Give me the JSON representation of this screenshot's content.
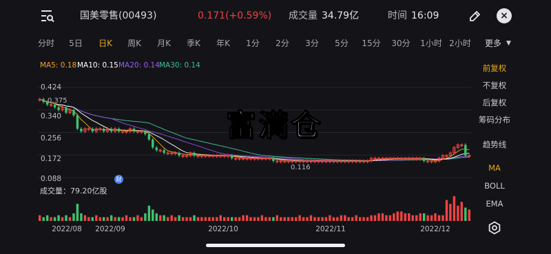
{
  "header": {
    "stock_name": "国美零售(00493)",
    "price_change": "0.171(+0.59%)",
    "volume_label": "成交量",
    "volume_value": "34.79亿",
    "time_label": "时间",
    "time_value": "16:09",
    "close_symbol": "×",
    "icons": [
      "menu-search-icon",
      "pencil-icon",
      "close-icon"
    ]
  },
  "tabs": [
    {
      "label": "分时",
      "active": false
    },
    {
      "label": "5日",
      "active": false
    },
    {
      "label": "日K",
      "active": true
    },
    {
      "label": "周K",
      "active": false
    },
    {
      "label": "月K",
      "active": false
    },
    {
      "label": "季K",
      "active": false
    },
    {
      "label": "年K",
      "active": false
    },
    {
      "label": "1分",
      "active": false
    },
    {
      "label": "2分",
      "active": false
    },
    {
      "label": "3分",
      "active": false
    },
    {
      "label": "5分",
      "active": false
    },
    {
      "label": "15分",
      "active": false
    },
    {
      "label": "30分",
      "active": false
    },
    {
      "label": "1小时",
      "active": false
    },
    {
      "label": "2小时",
      "active": false
    }
  ],
  "more_tab": "更多",
  "more_caret": "▼",
  "ma_legend": {
    "ma5": "MA5: 0.18",
    "ma10": "MA10: 0.15",
    "ma20": "MA20: 0.14",
    "ma30": "MA30: 0.14"
  },
  "y_axis_labels": [
    "0.424",
    "0.340",
    "0.256",
    "0.172",
    "0.088"
  ],
  "price_markers": {
    "high": "0.375",
    "low": "0.116"
  },
  "side_panel": {
    "adjust_options": [
      "前复权",
      "不复权",
      "后复权"
    ],
    "selected_adjust": "前复权",
    "chip_distribution": "筹码分布",
    "trendline": "趋势线",
    "indicators": [
      "MA",
      "BOLL",
      "EMA"
    ],
    "selected_indicator": "MA"
  },
  "volume_total": "成交量：79.20亿股",
  "x_axis_labels": [
    "2022/08",
    "2022/09",
    "2022/10",
    "2022/11",
    "2022/12"
  ],
  "watermark": "富满仓",
  "finance_badge": "财",
  "colors": {
    "up": "#ee4444",
    "down": "#3fc46f",
    "accent": "#e9a81a",
    "ma5": "#f0a41f",
    "ma10": "#ffffff",
    "ma20": "#8c4de0",
    "ma30": "#3fbf9a"
  },
  "chart_data": {
    "type": "candlestick",
    "ylim": [
      0.088,
      0.424
    ],
    "y_ticks": [
      0.424,
      0.34,
      0.256,
      0.172,
      0.088
    ],
    "x_ticks": [
      "2022/08",
      "2022/09",
      "2022/10",
      "2022/11",
      "2022/12"
    ],
    "price_high": 0.375,
    "price_low": 0.116,
    "ma": {
      "MA5": 0.18,
      "MA10": 0.15,
      "MA20": 0.14,
      "MA30": 0.14
    },
    "closes_approx": [
      0.38,
      0.37,
      0.36,
      0.36,
      0.35,
      0.34,
      0.35,
      0.33,
      0.34,
      0.32,
      0.27,
      0.26,
      0.27,
      0.27,
      0.26,
      0.27,
      0.27,
      0.26,
      0.27,
      0.26,
      0.27,
      0.26,
      0.26,
      0.26,
      0.27,
      0.26,
      0.26,
      0.26,
      0.25,
      0.23,
      0.2,
      0.19,
      0.19,
      0.18,
      0.18,
      0.18,
      0.18,
      0.17,
      0.17,
      0.17,
      0.18,
      0.17,
      0.17,
      0.17,
      0.17,
      0.17,
      0.17,
      0.17,
      0.17,
      0.17,
      0.17,
      0.16,
      0.16,
      0.16,
      0.16,
      0.16,
      0.16,
      0.16,
      0.16,
      0.16,
      0.16,
      0.16,
      0.15,
      0.15,
      0.15,
      0.15,
      0.15,
      0.15,
      0.15,
      0.15,
      0.15,
      0.15,
      0.15,
      0.15,
      0.15,
      0.15,
      0.15,
      0.15,
      0.15,
      0.15,
      0.15,
      0.15,
      0.15,
      0.15,
      0.15,
      0.15,
      0.15,
      0.15,
      0.16,
      0.16,
      0.16,
      0.16,
      0.16,
      0.16,
      0.16,
      0.16,
      0.16,
      0.16,
      0.16,
      0.16,
      0.16,
      0.16,
      0.15,
      0.15,
      0.15,
      0.15,
      0.16,
      0.17,
      0.17,
      0.18,
      0.2,
      0.21,
      0.21,
      0.17,
      0.17
    ],
    "volume_approx": [
      3,
      2,
      3,
      2,
      2,
      3,
      2,
      3,
      2,
      4,
      9,
      4,
      3,
      2,
      2,
      3,
      2,
      2,
      2,
      3,
      2,
      2,
      2,
      3,
      2,
      2,
      3,
      2,
      4,
      8,
      6,
      4,
      3,
      3,
      2,
      3,
      2,
      3,
      2,
      2,
      2,
      3,
      2,
      2,
      2,
      2,
      2,
      2,
      3,
      2,
      2,
      2,
      2,
      2,
      3,
      3,
      2,
      2,
      2,
      3,
      2,
      2,
      2,
      3,
      2,
      2,
      2,
      2,
      2,
      3,
      2,
      2,
      3,
      2,
      2,
      2,
      2,
      3,
      2,
      2,
      3,
      3,
      2,
      2,
      3,
      2,
      2,
      2,
      3,
      3,
      4,
      4,
      3,
      3,
      4,
      5,
      5,
      4,
      4,
      3,
      3,
      4,
      4,
      3,
      3,
      4,
      3,
      3,
      11,
      9,
      13,
      8,
      10,
      7,
      6
    ]
  }
}
